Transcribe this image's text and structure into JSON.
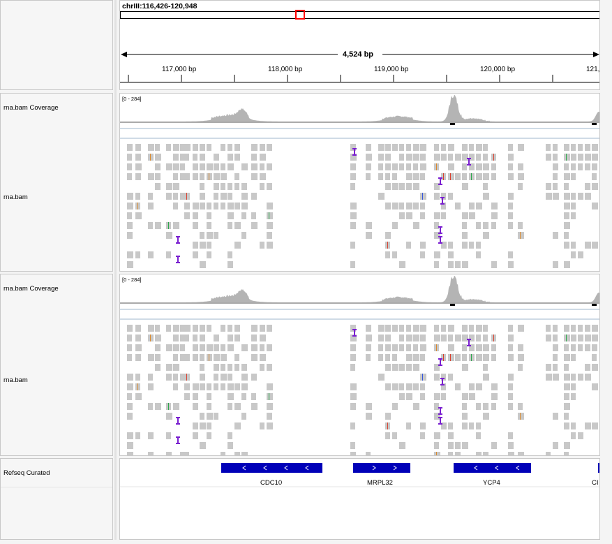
{
  "header": {
    "locus": "chrIII:116,426-120,948",
    "span_label": "4,524 bp",
    "ruler_labels": [
      "117,000 bp",
      "118,000 bp",
      "119,000 bp",
      "120,000 bp",
      "121,"
    ]
  },
  "tracks": {
    "coverage_label": "rna.bam Coverage",
    "alignment_label": "rna.bam",
    "data_range": "[0 - 284]",
    "refseq_label": "Refseq Curated"
  },
  "genes": [
    {
      "name": "CDC10",
      "strand": "-"
    },
    {
      "name": "MRPL32",
      "strand": "+"
    },
    {
      "name": "YCP4",
      "strand": "-"
    },
    {
      "name": "CI",
      "strand": "+"
    }
  ],
  "colors": {
    "gene": "#0000b8",
    "read": "#c8c8c8",
    "coverage": "#b4b4b4",
    "insertion": "#7a1fd0",
    "viewbox": "#ff0000"
  }
}
